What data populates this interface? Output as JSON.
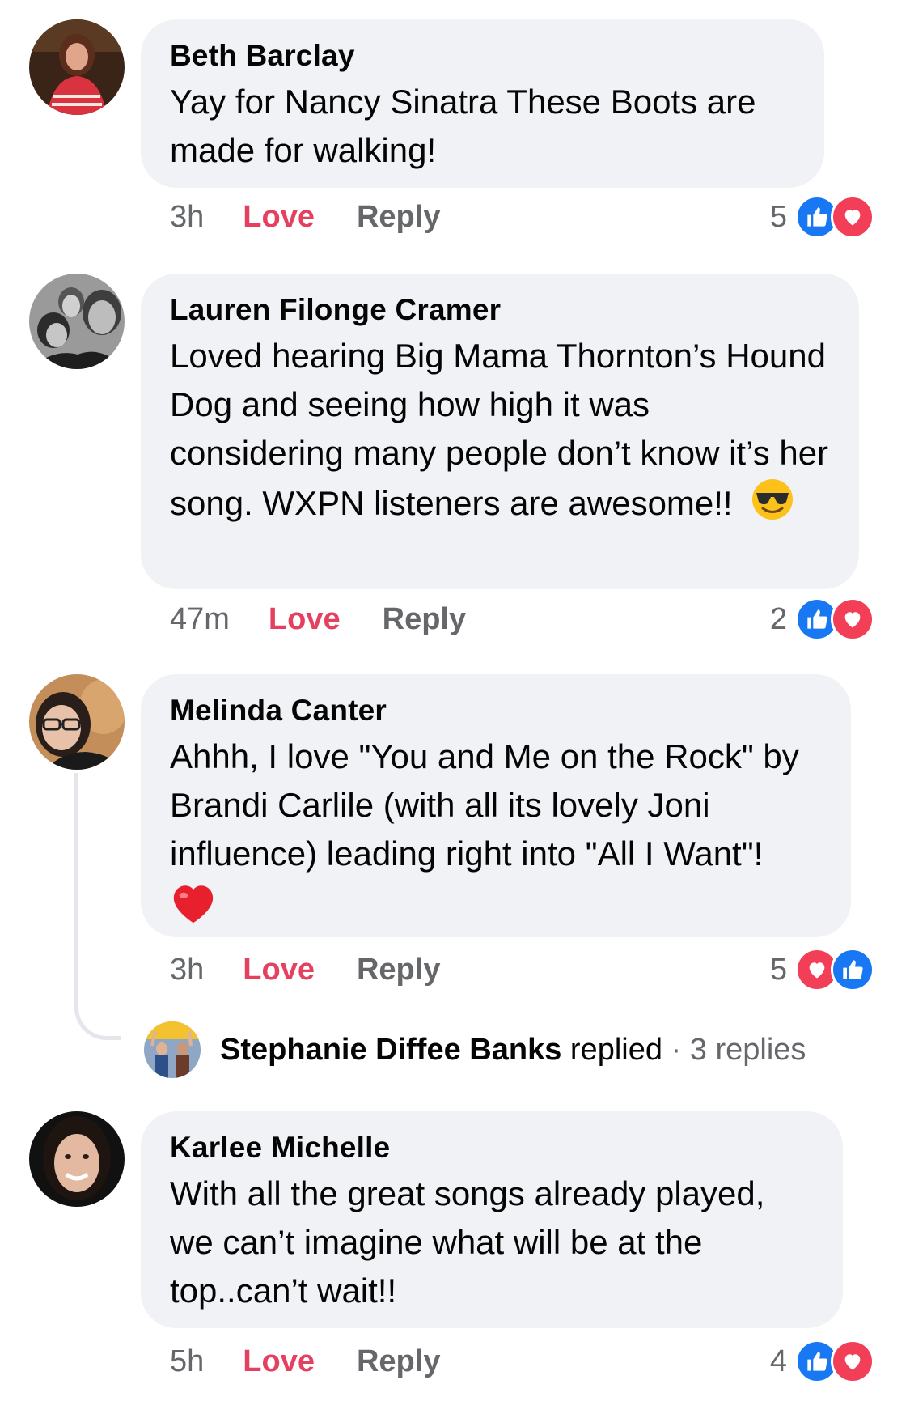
{
  "colors": {
    "bubble": "#f0f2f5",
    "love": "#e4405f",
    "muted": "#65676b",
    "like_blue": "#1877f2",
    "heart_red": "#f33e58"
  },
  "comments": [
    {
      "author": "Beth Barclay",
      "text": "Yay for Nancy Sinatra These Boots are made for walking!",
      "time": "3h",
      "love_label": "Love",
      "reply_label": "Reply",
      "reaction_count": "5",
      "reactions": [
        "like-icon",
        "heart-icon"
      ]
    },
    {
      "author": "Lauren Filonge Cramer",
      "text": "Loved hearing Big Mama Thornton’s Hound Dog and seeing how high it was considering many people don’t know it’s her song.  WXPN listeners are awesome!!",
      "emoji": "😎",
      "time": "47m",
      "love_label": "Love",
      "reply_label": "Reply",
      "reaction_count": "2",
      "reactions": [
        "like-icon",
        "heart-icon"
      ]
    },
    {
      "author": "Melinda Canter",
      "text": "Ahhh, I love \"You and Me on the Rock\" by Brandi Carlile (with all its lovely Joni influence) leading right into \"All I Want\"!",
      "emoji": "❤️",
      "time": "3h",
      "love_label": "Love",
      "reply_label": "Reply",
      "reaction_count": "5",
      "reactions": [
        "heart-icon",
        "like-icon"
      ],
      "replies": {
        "name": "Stephanie Diffee Banks",
        "verb": "replied",
        "separator": "·",
        "count_label": "3 replies"
      }
    },
    {
      "author": "Karlee Michelle",
      "text": "With all the great songs already played, we can’t imagine what will be at the top..can’t wait!!",
      "time": "5h",
      "love_label": "Love",
      "reply_label": "Reply",
      "reaction_count": "4",
      "reactions": [
        "like-icon",
        "heart-icon"
      ]
    }
  ]
}
